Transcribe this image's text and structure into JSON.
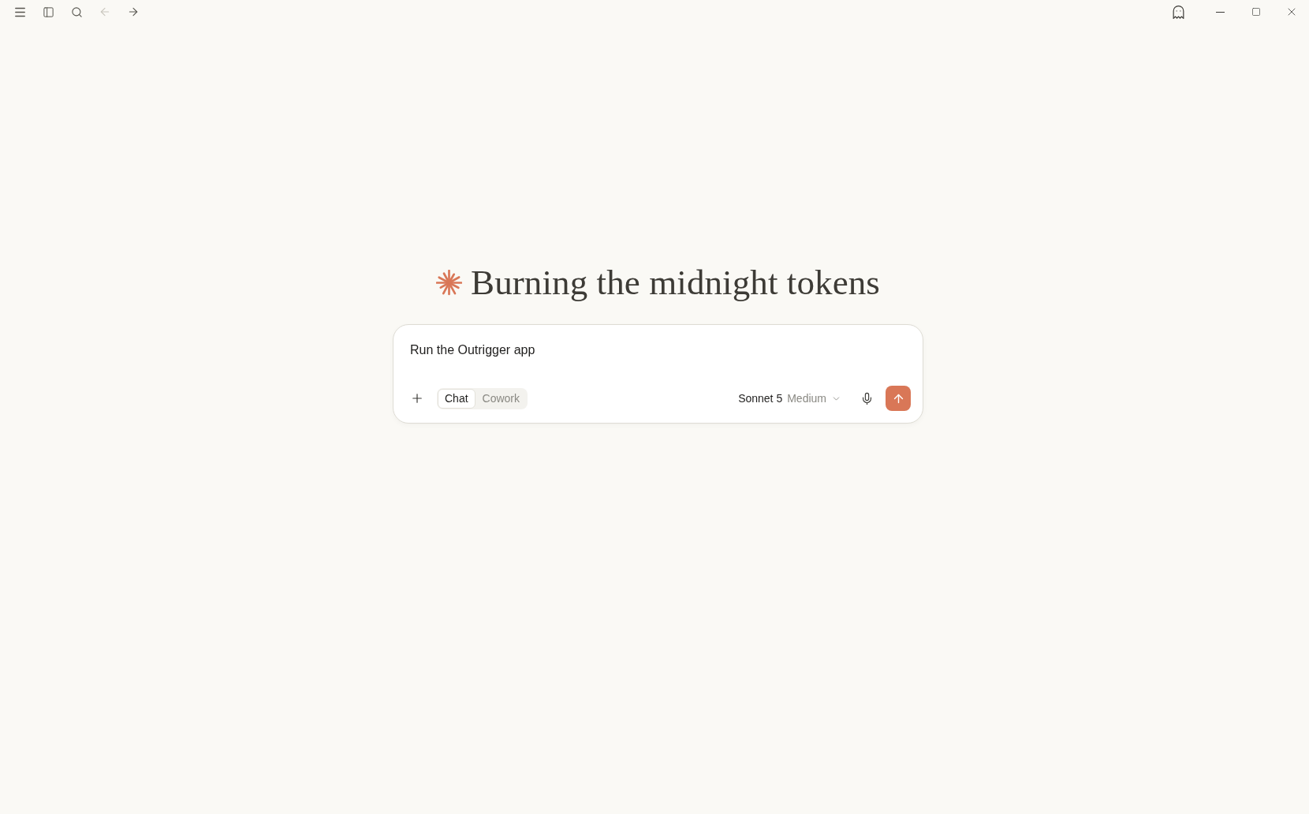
{
  "title_bar": {
    "nav_buttons": [
      {
        "kind": "back",
        "disabled": true
      },
      {
        "kind": "forward",
        "disabled": false
      }
    ]
  },
  "greeting": {
    "text": "Burning the midnight tokens"
  },
  "composer": {
    "value": "Run the Outrigger app",
    "modes": [
      {
        "label": "Chat",
        "selected": true
      },
      {
        "label": "Cowork",
        "selected": false
      }
    ],
    "model": "Sonnet 5",
    "effort": "Medium",
    "send": {
      "disabled": false
    }
  }
}
